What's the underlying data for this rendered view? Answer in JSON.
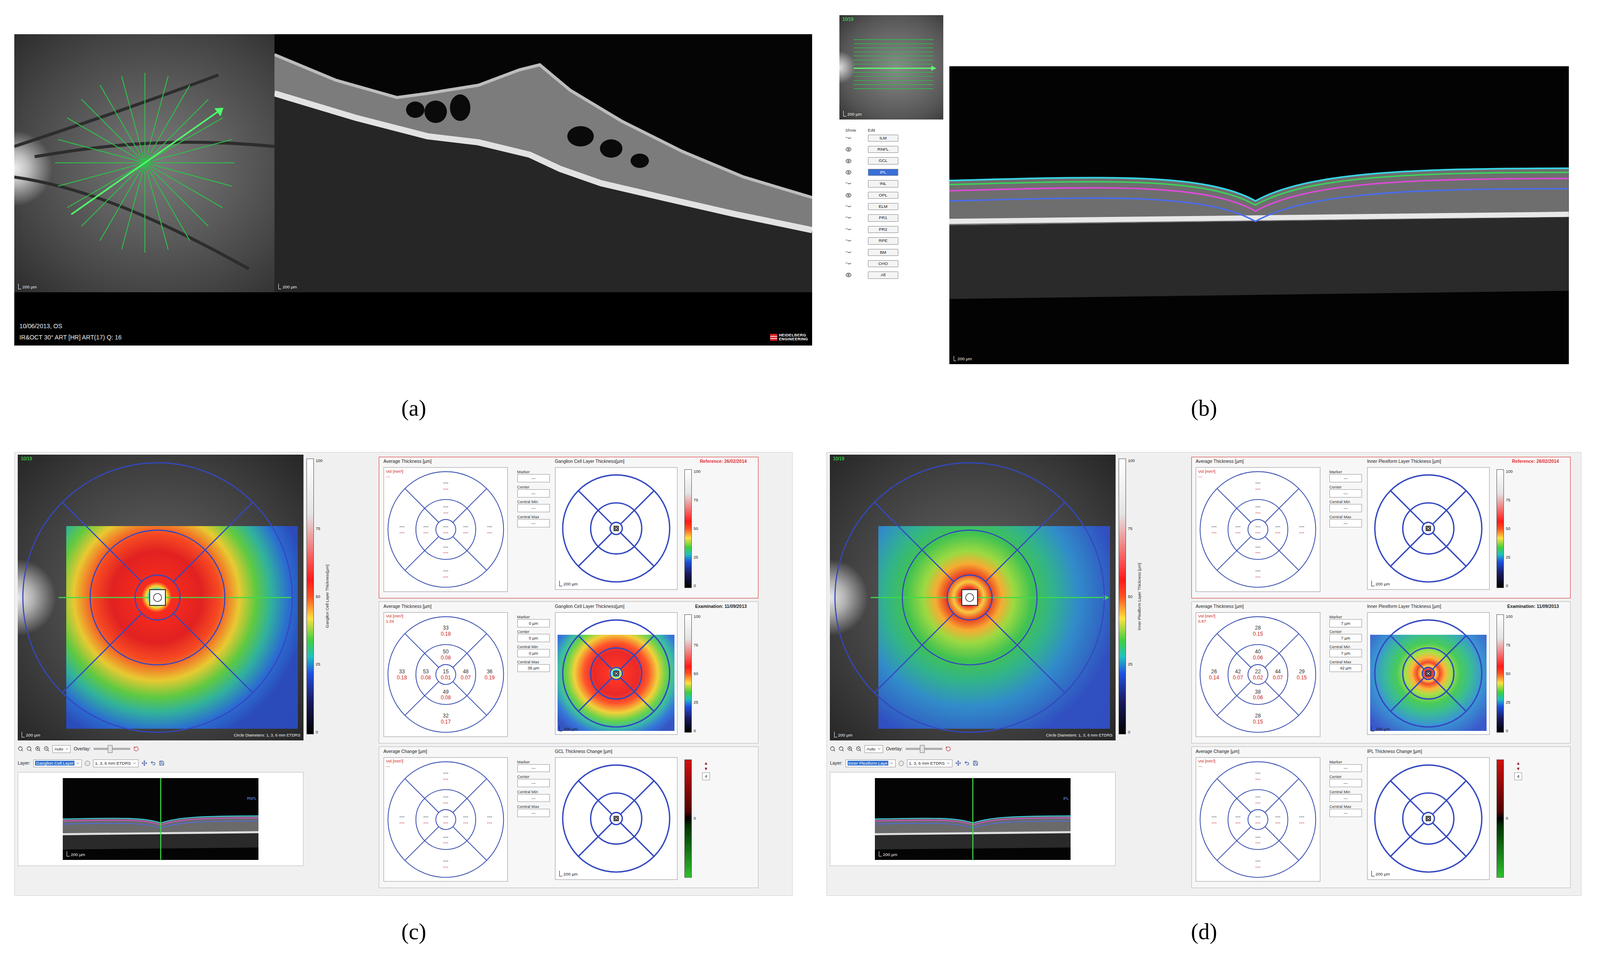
{
  "panel_a": {
    "label": "(a)",
    "fundus_scale": "200 µm",
    "bscan_scale": "200 µm",
    "date": "10/06/2013, OS",
    "mode": "IR&OCT 30° ART [HR] ART(17) Q: 16",
    "logo": [
      "HEIDELBERG",
      "ENGINEERING"
    ]
  },
  "panel_b": {
    "label": "(b)",
    "thumb_index": "10/19",
    "thumb_scale": "200 µm",
    "bscan_scale": "200 µm",
    "columns": [
      "Show",
      "Edit"
    ],
    "layers": [
      {
        "name": "ILM",
        "visible": false,
        "selected": false
      },
      {
        "name": "RNFL",
        "visible": true,
        "selected": false
      },
      {
        "name": "GCL",
        "visible": true,
        "selected": false
      },
      {
        "name": "IPL",
        "visible": true,
        "selected": true
      },
      {
        "name": "INL",
        "visible": false,
        "selected": false
      },
      {
        "name": "OPL",
        "visible": true,
        "selected": false
      },
      {
        "name": "ELM",
        "visible": false,
        "selected": false
      },
      {
        "name": "PR1",
        "visible": false,
        "selected": false
      },
      {
        "name": "PR2",
        "visible": false,
        "selected": false
      },
      {
        "name": "RPE",
        "visible": false,
        "selected": false
      },
      {
        "name": "BM",
        "visible": false,
        "selected": false
      },
      {
        "name": "CHO",
        "visible": false,
        "selected": false
      },
      {
        "name": "All",
        "visible": true,
        "selected": false
      }
    ]
  },
  "maps": [
    {
      "label": "(c)",
      "kind": "gcl",
      "index": "10/19",
      "scale": "200 µm",
      "circle_note": "Circle Diameters: 1, 3, 6 mm ETDRS",
      "colorbar": {
        "title": "Ganglion Cell Layer Thickness[µm]",
        "ticks": [
          "100",
          "75",
          "50",
          "25",
          "0"
        ]
      },
      "zoom": "Auto",
      "overlay_label": "Overlay:",
      "overlay_level": 0.45,
      "layer_label": "Layer:",
      "layer": "Ganglion Cell Layer",
      "grid_option": "1, 3, 6 mm ETDRS",
      "thumb_scale": "200 µm",
      "thumb_tag": "RNFL",
      "boxes": [
        {
          "kind": "reference",
          "highlighted": true,
          "avg_title": "Average Thickness [µm]",
          "vol_label": "Vol [mm³]",
          "vol": "---",
          "sectors": [
            {
              "value": "---",
              "vol": "---"
            },
            {
              "value": "---",
              "vol": "---"
            },
            {
              "value": "---",
              "vol": "---"
            },
            {
              "value": "---",
              "vol": "---"
            },
            {
              "value": "---",
              "vol": "---"
            },
            {
              "value": "---",
              "vol": "---"
            },
            {
              "value": "---",
              "vol": "---"
            },
            {
              "value": "---",
              "vol": "---"
            },
            {
              "value": "---",
              "vol": "---"
            }
          ],
          "fields": [
            {
              "label": "Marker",
              "value": "---"
            },
            {
              "label": "Center",
              "value": "---"
            },
            {
              "label": "Central Min",
              "value": "---"
            },
            {
              "label": "Central Max",
              "value": "---"
            }
          ],
          "map_title": "Ganglion Cell Layer Thickness[µm]",
          "date": "Reference: 26/02/2014",
          "map_scale": "200 µm",
          "ticks": [
            "100",
            "75",
            "50",
            "25",
            "0"
          ]
        },
        {
          "kind": "examination",
          "highlighted": false,
          "avg_title": "Average Thickness [µm]",
          "vol_label": "Vol [mm³]",
          "vol": "1.04",
          "sectors": [
            {
              "value": "33",
              "vol": "0.18"
            },
            {
              "value": "50",
              "vol": "0.08"
            },
            {
              "value": "33",
              "vol": "0.18"
            },
            {
              "value": "53",
              "vol": "0.08"
            },
            {
              "value": "15",
              "vol": "0.01"
            },
            {
              "value": "48",
              "vol": "0.07"
            },
            {
              "value": "36",
              "vol": "0.19"
            },
            {
              "value": "49",
              "vol": "0.08"
            },
            {
              "value": "32",
              "vol": "0.17"
            }
          ],
          "fields": [
            {
              "label": "Marker",
              "value": "0 µm"
            },
            {
              "label": "Center",
              "value": "0 µm"
            },
            {
              "label": "Central Min",
              "value": "0 µm"
            },
            {
              "label": "Central Max",
              "value": "35 µm"
            }
          ],
          "map_title": "Ganglion Cell Layer Thickness[µm]",
          "date": "Examination: 11/09/2013",
          "map_scale": "200 µm",
          "ticks": [
            "100",
            "75",
            "50",
            "25",
            "0"
          ]
        },
        {
          "kind": "change",
          "highlighted": false,
          "avg_title": "Average Change [µm]",
          "vol_label": "Vol [mm³]",
          "vol": "---",
          "sectors": [
            {
              "value": "---",
              "vol": "---"
            },
            {
              "value": "---",
              "vol": "---"
            },
            {
              "value": "---",
              "vol": "---"
            },
            {
              "value": "---",
              "vol": "---"
            },
            {
              "value": "---",
              "vol": "---"
            },
            {
              "value": "---",
              "vol": "---"
            },
            {
              "value": "---",
              "vol": "---"
            },
            {
              "value": "---",
              "vol": "---"
            },
            {
              "value": "---",
              "vol": "---"
            }
          ],
          "fields": [
            {
              "label": "Marker",
              "value": "---"
            },
            {
              "label": "Center",
              "value": "---"
            },
            {
              "label": "Central Min",
              "value": "---"
            },
            {
              "label": "Central Max",
              "value": "---"
            }
          ],
          "map_title": "GCL Thickness Change [µm]",
          "map_scale": "200 µm",
          "ticks": [
            "0"
          ],
          "step_up": "▲",
          "step_down": "▼",
          "step": "4"
        }
      ]
    },
    {
      "label": "(d)",
      "kind": "ipl",
      "index": "10/19",
      "scale": "200 µm",
      "circle_note": "Circle Diameters: 1, 3, 6 mm ETDRS",
      "colorbar": {
        "title": "Inner Plexiform Layer Thickness [µm]",
        "ticks": [
          "100",
          "75",
          "50",
          "25",
          "0"
        ]
      },
      "zoom": "Auto",
      "overlay_label": "Overlay:",
      "overlay_level": 0.45,
      "layer_label": "Layer:",
      "layer": "Inner Plexiform Laye",
      "grid_option": "1, 3, 6 mm ETDRS",
      "thumb_scale": "200 µm",
      "thumb_tag": "IPL",
      "boxes": [
        {
          "kind": "reference",
          "highlighted": true,
          "avg_title": "Average Thickness [µm]",
          "vol_label": "Vol [mm³]",
          "vol": "---",
          "sectors": [
            {
              "value": "---",
              "vol": "---"
            },
            {
              "value": "---",
              "vol": "---"
            },
            {
              "value": "---",
              "vol": "---"
            },
            {
              "value": "---",
              "vol": "---"
            },
            {
              "value": "---",
              "vol": "---"
            },
            {
              "value": "---",
              "vol": "---"
            },
            {
              "value": "---",
              "vol": "---"
            },
            {
              "value": "---",
              "vol": "---"
            },
            {
              "value": "---",
              "vol": "---"
            }
          ],
          "fields": [
            {
              "label": "Marker",
              "value": "---"
            },
            {
              "label": "Center",
              "value": "---"
            },
            {
              "label": "Central Min",
              "value": "---"
            },
            {
              "label": "Central Max",
              "value": "---"
            }
          ],
          "map_title": "Inner Plexiform Layer Thickness [µm]",
          "date": "Reference: 26/02/2014",
          "map_scale": "200 µm",
          "ticks": [
            "100",
            "75",
            "50",
            "25",
            "0"
          ]
        },
        {
          "kind": "examination",
          "highlighted": false,
          "avg_title": "Average Thickness [µm]",
          "vol_label": "Vol [mm³]",
          "vol": "0.87",
          "sectors": [
            {
              "value": "28",
              "vol": "0.15"
            },
            {
              "value": "40",
              "vol": "0.06"
            },
            {
              "value": "26",
              "vol": "0.14"
            },
            {
              "value": "42",
              "vol": "0.07"
            },
            {
              "value": "22",
              "vol": "0.02"
            },
            {
              "value": "44",
              "vol": "0.07"
            },
            {
              "value": "29",
              "vol": "0.15"
            },
            {
              "value": "38",
              "vol": "0.06"
            },
            {
              "value": "28",
              "vol": "0.15"
            }
          ],
          "fields": [
            {
              "label": "Marker",
              "value": "7 µm"
            },
            {
              "label": "Center",
              "value": "7 µm"
            },
            {
              "label": "Central Min",
              "value": "7 µm"
            },
            {
              "label": "Central Max",
              "value": "42 µm"
            }
          ],
          "map_title": "Inner Plexiform Layer Thickness [µm]",
          "date": "Examination: 11/09/2013",
          "map_scale": "200 µm",
          "ticks": [
            "100",
            "75",
            "50",
            "25",
            "0"
          ]
        },
        {
          "kind": "change",
          "highlighted": false,
          "avg_title": "Average Change [µm]",
          "vol_label": "Vol [mm³]",
          "vol": "---",
          "sectors": [
            {
              "value": "---",
              "vol": "---"
            },
            {
              "value": "---",
              "vol": "---"
            },
            {
              "value": "---",
              "vol": "---"
            },
            {
              "value": "---",
              "vol": "---"
            },
            {
              "value": "---",
              "vol": "---"
            },
            {
              "value": "---",
              "vol": "---"
            },
            {
              "value": "---",
              "vol": "---"
            },
            {
              "value": "---",
              "vol": "---"
            },
            {
              "value": "---",
              "vol": "---"
            }
          ],
          "fields": [
            {
              "label": "Marker",
              "value": "---"
            },
            {
              "label": "Center",
              "value": "---"
            },
            {
              "label": "Central Min",
              "value": "---"
            },
            {
              "label": "Central Max",
              "value": "---"
            }
          ],
          "map_title": "IPL Thickness Change [µm]",
          "map_scale": "200 µm",
          "ticks": [
            "0"
          ],
          "step_up": "▲",
          "step_down": "▼",
          "step": "4"
        }
      ]
    }
  ]
}
